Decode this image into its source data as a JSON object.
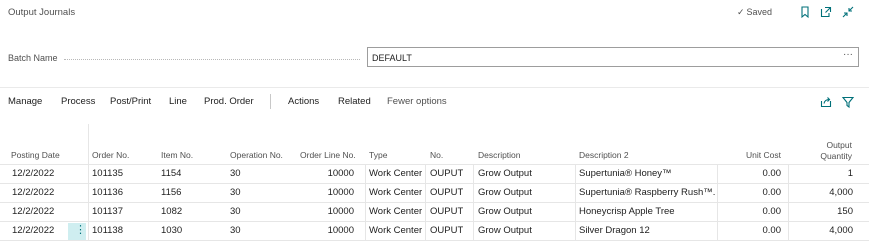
{
  "page": {
    "title": "Output Journals",
    "saved_label": "Saved",
    "colors": {
      "accent": "#007079",
      "row_menu_bg": "#cfeef0",
      "text": "#212121",
      "muted": "#505050"
    },
    "icons": [
      "bookmark-icon",
      "open-new-window-icon",
      "collapse-icon"
    ]
  },
  "batch": {
    "label": "Batch Name",
    "value": "DEFAULT",
    "more_label": "···"
  },
  "actions": {
    "items": [
      "Manage",
      "Process",
      "Post/Print",
      "Line",
      "Prod. Order"
    ],
    "items2": [
      "Actions",
      "Related",
      "Fewer options"
    ],
    "icons": [
      "share-icon",
      "filter-icon"
    ]
  },
  "table": {
    "columns": {
      "posting_date": "Posting Date",
      "order_no": "Order No.",
      "item_no": "Item No.",
      "operation_no": "Operation No.",
      "order_line_no": "Order Line No.",
      "type": "Type",
      "no": "No.",
      "description": "Description",
      "description2": "Description 2",
      "unit_cost": "Unit Cost",
      "output_quantity_1": "Output",
      "output_quantity_2": "Quantity"
    },
    "rows": [
      {
        "posting_date": "12/2/2022",
        "order_no": "101135",
        "item_no": "1154",
        "operation_no": "30",
        "order_line_no": "10000",
        "type": "Work Center",
        "no": "OUPUT",
        "description": "Grow Output",
        "description2": "Supertunia® Honey™",
        "unit_cost": "0.00",
        "output_quantity": "1"
      },
      {
        "posting_date": "12/2/2022",
        "order_no": "101136",
        "item_no": "1156",
        "operation_no": "30",
        "order_line_no": "10000",
        "type": "Work Center",
        "no": "OUPUT",
        "description": "Grow Output",
        "description2": "Supertunia® Raspberry Rush™...",
        "unit_cost": "0.00",
        "output_quantity": "4,000"
      },
      {
        "posting_date": "12/2/2022",
        "order_no": "101137",
        "item_no": "1082",
        "operation_no": "30",
        "order_line_no": "10000",
        "type": "Work Center",
        "no": "OUPUT",
        "description": "Grow Output",
        "description2": "Honeycrisp Apple Tree",
        "unit_cost": "0.00",
        "output_quantity": "150"
      },
      {
        "posting_date": "12/2/2022",
        "order_no": "101138",
        "item_no": "1030",
        "operation_no": "30",
        "order_line_no": "10000",
        "type": "Work Center",
        "no": "OUPUT",
        "description": "Grow Output",
        "description2": "Silver Dragon 12",
        "unit_cost": "0.00",
        "output_quantity": "4,000"
      }
    ],
    "row_menu_glyph": "⋮"
  }
}
